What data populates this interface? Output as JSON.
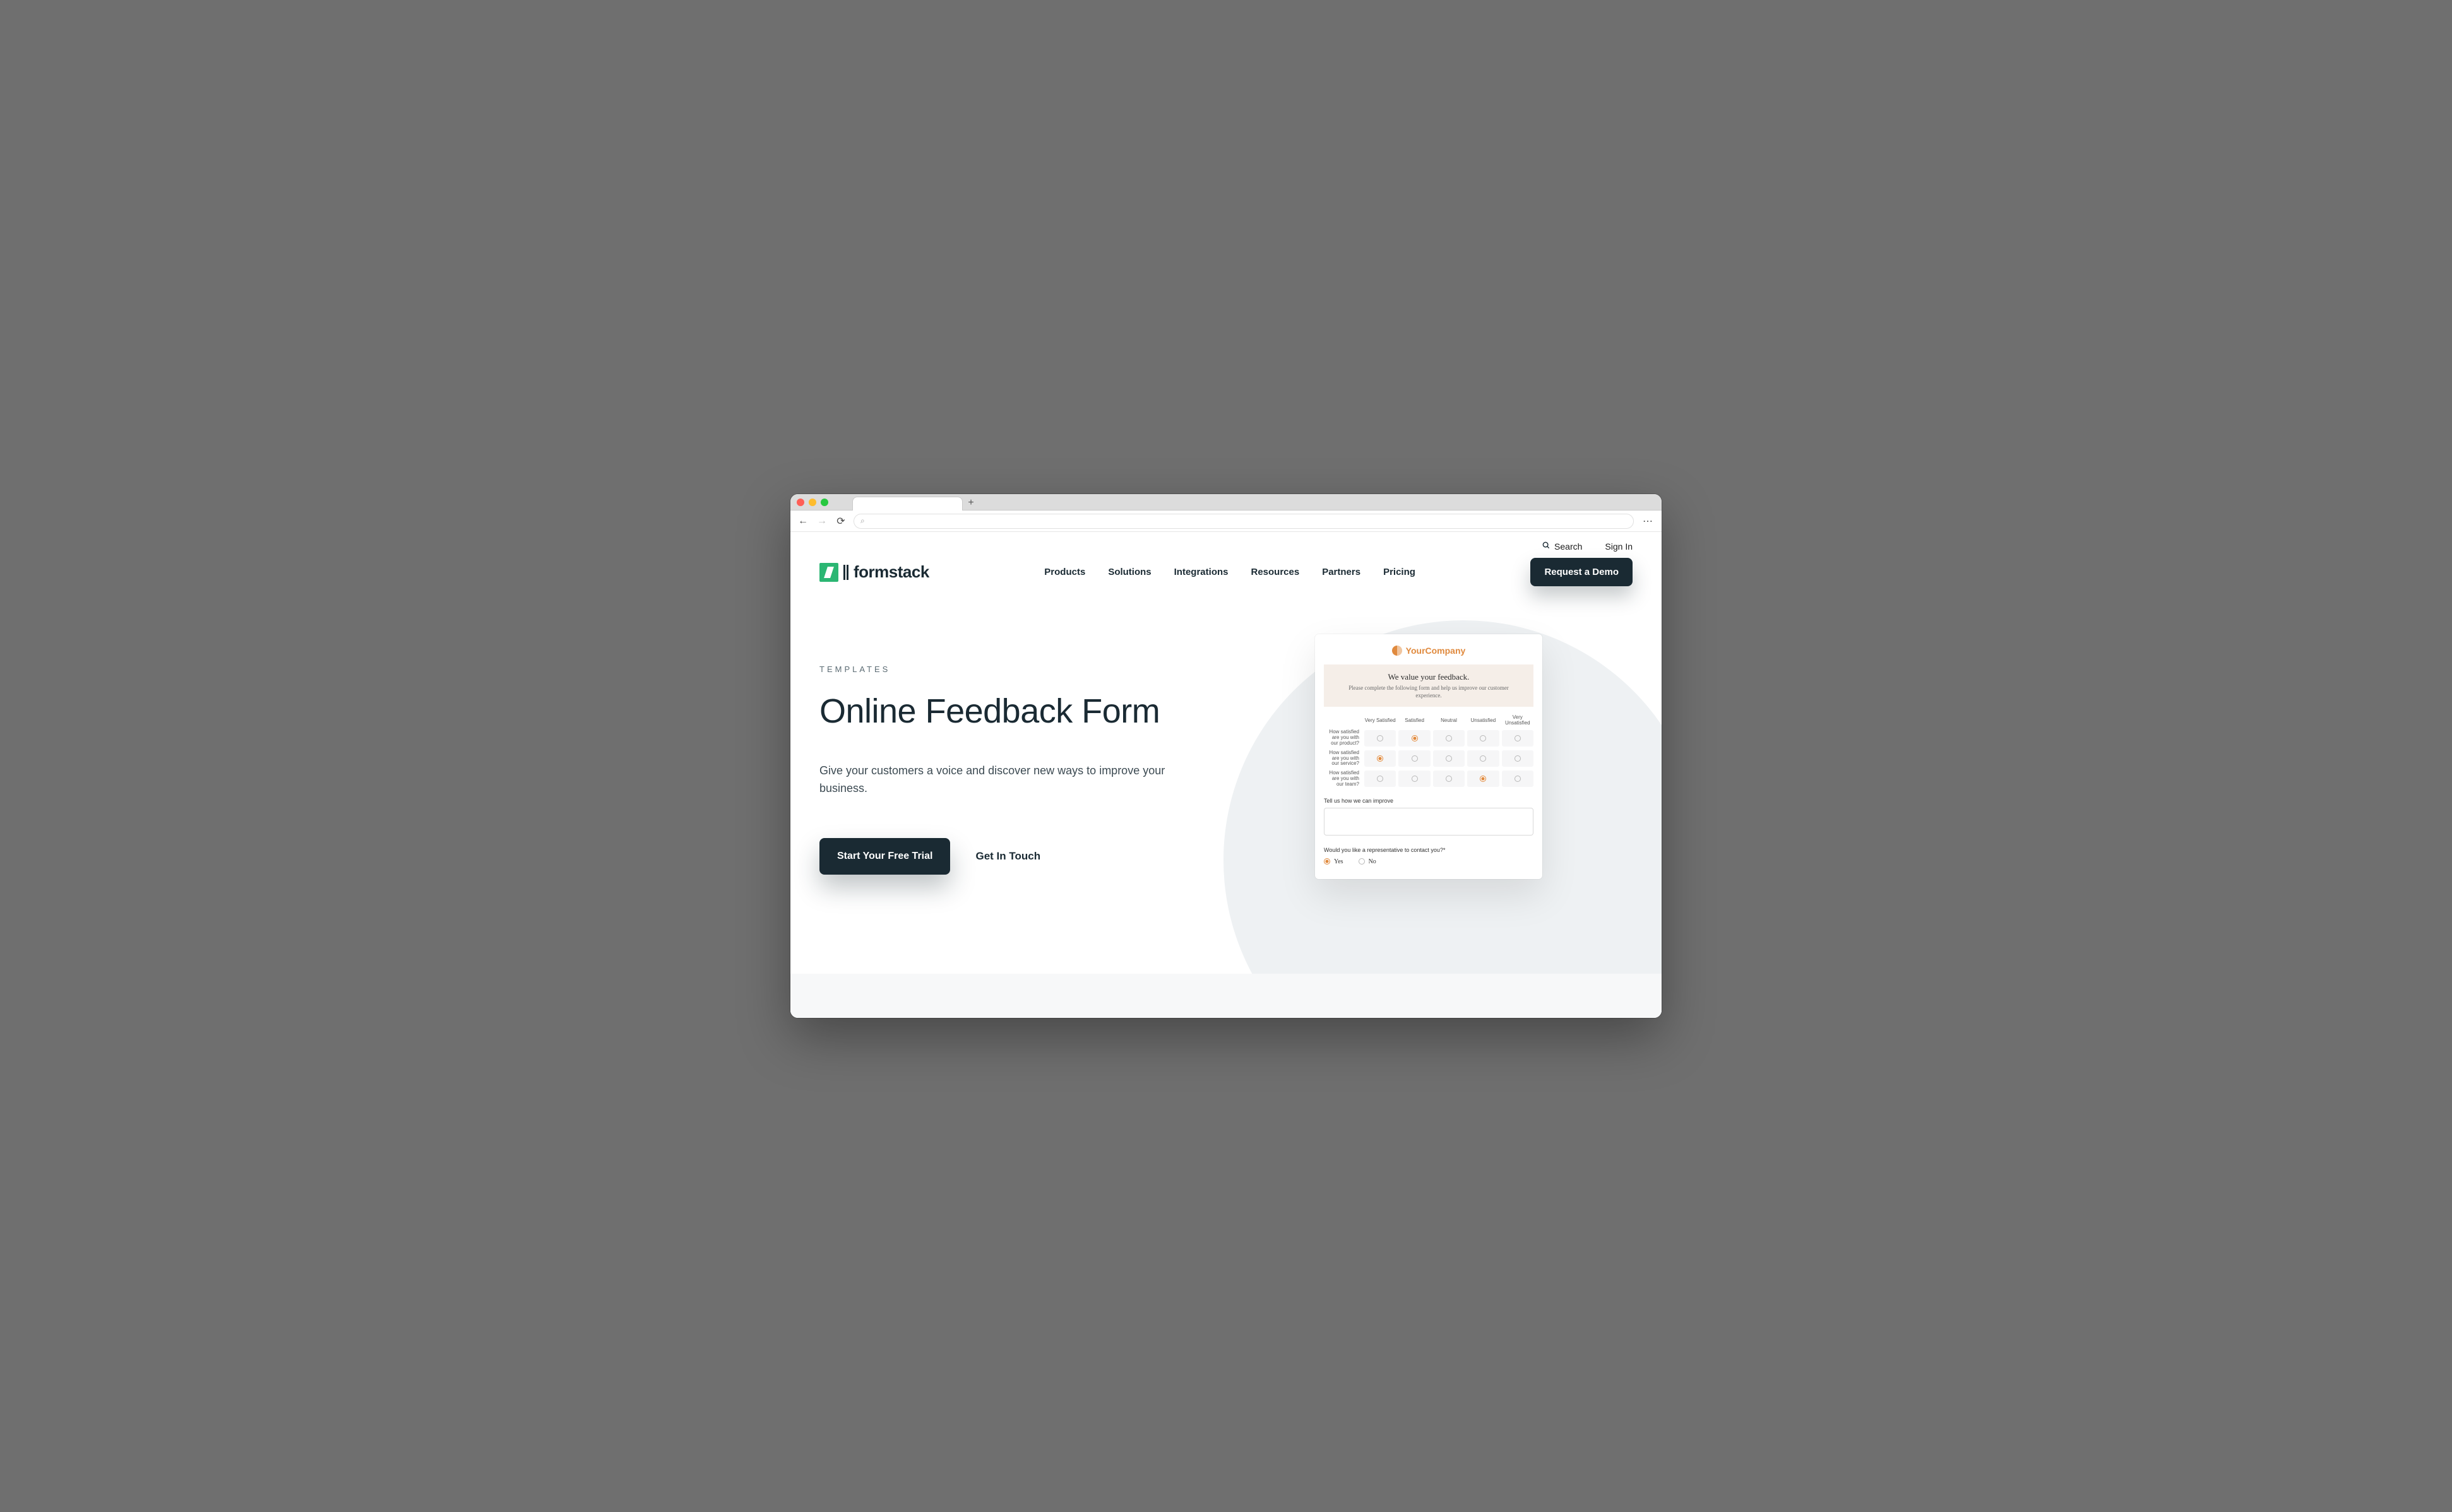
{
  "browser": {
    "newtab_glyph": "+",
    "back_glyph": "←",
    "fwd_glyph": "→",
    "reload_glyph": "⟳",
    "search_glyph": "⌕",
    "menu_glyph": "⋯"
  },
  "topbar": {
    "search_label": "Search",
    "signin_label": "Sign In"
  },
  "brand": {
    "name": "formstack"
  },
  "nav": {
    "products": "Products",
    "solutions": "Solutions",
    "integrations": "Integrations",
    "resources": "Resources",
    "partners": "Partners",
    "pricing": "Pricing"
  },
  "cta": {
    "demo": "Request a Demo",
    "trial": "Start Your Free Trial",
    "contact": "Get In Touch"
  },
  "hero": {
    "eyebrow": "TEMPLATES",
    "title": "Online Feedback Form",
    "lede": "Give your customers a voice and discover new ways to improve your business."
  },
  "mock": {
    "company": "YourCompany",
    "banner_title": "We value your feedback.",
    "banner_sub": "Please complete the following form and help us improve our customer experience.",
    "scale": {
      "c1": "Very Satisfied",
      "c2": "Satisfied",
      "c3": "Neutral",
      "c4": "Unsatisfied",
      "c5": "Very Unsatisfied"
    },
    "q1": "How satisfied are you with our product?",
    "q2": "How satisfied are you with our service?",
    "q3": "How satisfied are you with our team?",
    "improve_label": "Tell us how we can improve",
    "contact_q": "Would you like a representative to contact you?*",
    "yes": "Yes",
    "no": "No"
  }
}
